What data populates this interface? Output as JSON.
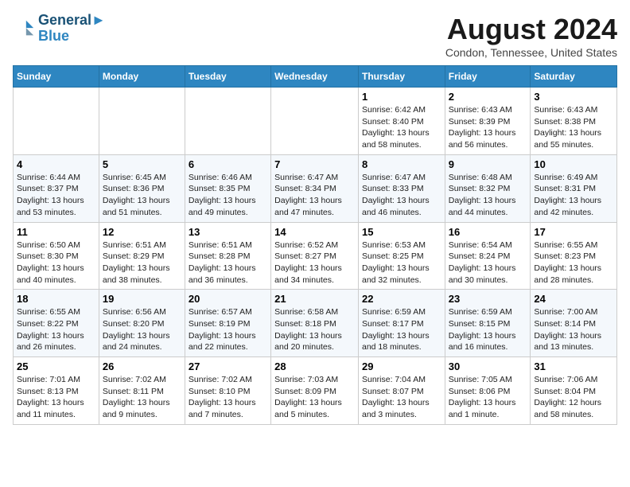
{
  "logo": {
    "line1": "General",
    "line2": "Blue"
  },
  "title": "August 2024",
  "subtitle": "Condon, Tennessee, United States",
  "days": [
    "Sunday",
    "Monday",
    "Tuesday",
    "Wednesday",
    "Thursday",
    "Friday",
    "Saturday"
  ],
  "weeks": [
    [
      {
        "num": "",
        "content": ""
      },
      {
        "num": "",
        "content": ""
      },
      {
        "num": "",
        "content": ""
      },
      {
        "num": "",
        "content": ""
      },
      {
        "num": "1",
        "content": "Sunrise: 6:42 AM\nSunset: 8:40 PM\nDaylight: 13 hours and 58 minutes."
      },
      {
        "num": "2",
        "content": "Sunrise: 6:43 AM\nSunset: 8:39 PM\nDaylight: 13 hours and 56 minutes."
      },
      {
        "num": "3",
        "content": "Sunrise: 6:43 AM\nSunset: 8:38 PM\nDaylight: 13 hours and 55 minutes."
      }
    ],
    [
      {
        "num": "4",
        "content": "Sunrise: 6:44 AM\nSunset: 8:37 PM\nDaylight: 13 hours and 53 minutes."
      },
      {
        "num": "5",
        "content": "Sunrise: 6:45 AM\nSunset: 8:36 PM\nDaylight: 13 hours and 51 minutes."
      },
      {
        "num": "6",
        "content": "Sunrise: 6:46 AM\nSunset: 8:35 PM\nDaylight: 13 hours and 49 minutes."
      },
      {
        "num": "7",
        "content": "Sunrise: 6:47 AM\nSunset: 8:34 PM\nDaylight: 13 hours and 47 minutes."
      },
      {
        "num": "8",
        "content": "Sunrise: 6:47 AM\nSunset: 8:33 PM\nDaylight: 13 hours and 46 minutes."
      },
      {
        "num": "9",
        "content": "Sunrise: 6:48 AM\nSunset: 8:32 PM\nDaylight: 13 hours and 44 minutes."
      },
      {
        "num": "10",
        "content": "Sunrise: 6:49 AM\nSunset: 8:31 PM\nDaylight: 13 hours and 42 minutes."
      }
    ],
    [
      {
        "num": "11",
        "content": "Sunrise: 6:50 AM\nSunset: 8:30 PM\nDaylight: 13 hours and 40 minutes."
      },
      {
        "num": "12",
        "content": "Sunrise: 6:51 AM\nSunset: 8:29 PM\nDaylight: 13 hours and 38 minutes."
      },
      {
        "num": "13",
        "content": "Sunrise: 6:51 AM\nSunset: 8:28 PM\nDaylight: 13 hours and 36 minutes."
      },
      {
        "num": "14",
        "content": "Sunrise: 6:52 AM\nSunset: 8:27 PM\nDaylight: 13 hours and 34 minutes."
      },
      {
        "num": "15",
        "content": "Sunrise: 6:53 AM\nSunset: 8:25 PM\nDaylight: 13 hours and 32 minutes."
      },
      {
        "num": "16",
        "content": "Sunrise: 6:54 AM\nSunset: 8:24 PM\nDaylight: 13 hours and 30 minutes."
      },
      {
        "num": "17",
        "content": "Sunrise: 6:55 AM\nSunset: 8:23 PM\nDaylight: 13 hours and 28 minutes."
      }
    ],
    [
      {
        "num": "18",
        "content": "Sunrise: 6:55 AM\nSunset: 8:22 PM\nDaylight: 13 hours and 26 minutes."
      },
      {
        "num": "19",
        "content": "Sunrise: 6:56 AM\nSunset: 8:20 PM\nDaylight: 13 hours and 24 minutes."
      },
      {
        "num": "20",
        "content": "Sunrise: 6:57 AM\nSunset: 8:19 PM\nDaylight: 13 hours and 22 minutes."
      },
      {
        "num": "21",
        "content": "Sunrise: 6:58 AM\nSunset: 8:18 PM\nDaylight: 13 hours and 20 minutes."
      },
      {
        "num": "22",
        "content": "Sunrise: 6:59 AM\nSunset: 8:17 PM\nDaylight: 13 hours and 18 minutes."
      },
      {
        "num": "23",
        "content": "Sunrise: 6:59 AM\nSunset: 8:15 PM\nDaylight: 13 hours and 16 minutes."
      },
      {
        "num": "24",
        "content": "Sunrise: 7:00 AM\nSunset: 8:14 PM\nDaylight: 13 hours and 13 minutes."
      }
    ],
    [
      {
        "num": "25",
        "content": "Sunrise: 7:01 AM\nSunset: 8:13 PM\nDaylight: 13 hours and 11 minutes."
      },
      {
        "num": "26",
        "content": "Sunrise: 7:02 AM\nSunset: 8:11 PM\nDaylight: 13 hours and 9 minutes."
      },
      {
        "num": "27",
        "content": "Sunrise: 7:02 AM\nSunset: 8:10 PM\nDaylight: 13 hours and 7 minutes."
      },
      {
        "num": "28",
        "content": "Sunrise: 7:03 AM\nSunset: 8:09 PM\nDaylight: 13 hours and 5 minutes."
      },
      {
        "num": "29",
        "content": "Sunrise: 7:04 AM\nSunset: 8:07 PM\nDaylight: 13 hours and 3 minutes."
      },
      {
        "num": "30",
        "content": "Sunrise: 7:05 AM\nSunset: 8:06 PM\nDaylight: 13 hours and 1 minute."
      },
      {
        "num": "31",
        "content": "Sunrise: 7:06 AM\nSunset: 8:04 PM\nDaylight: 12 hours and 58 minutes."
      }
    ]
  ]
}
